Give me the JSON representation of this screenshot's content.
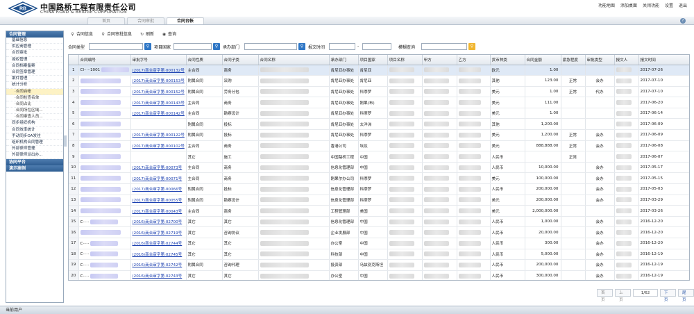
{
  "company": {
    "name_cn": "中国路桥工程有限责任公司",
    "name_en": "CHINA ROAD & BRIDGE CORPORATION",
    "logo_text": "RB"
  },
  "top_links": [
    "功能地图",
    "添加桌面",
    "关闭功能",
    "设置",
    "退出"
  ],
  "tabs": [
    "首页",
    "合同审批",
    "合同台帐"
  ],
  "sidebar": {
    "groups": [
      {
        "title": "合同管理",
        "items": [
          "基础信息",
          "供应商管理",
          "合同审批",
          "授权管理",
          "合同档案备案",
          "合同签章管理",
          "案件管理",
          "统计分析",
          "·合同台帐",
          "·合同检查名单",
          "·合同占比",
          "·合同所在区域...",
          "·合同审查人员...",
          "同步组织机构",
          "合同效率统计",
          "手动同步OA发往",
          "组织机构合同管理",
          "外部律师管理",
          "外部律师派出办..."
        ]
      },
      {
        "title": "协同平台",
        "items": []
      },
      {
        "title": "演示案例",
        "items": []
      }
    ]
  },
  "toolbar": {
    "btn1": "合同信息",
    "btn2": "合同审批信息",
    "btn3": "刷新",
    "btn4": "查询"
  },
  "filters": {
    "contract_type": "合同类型",
    "project_country": "项目国家",
    "dept": "承办部门",
    "submit_time": "报文时间",
    "dash": "-",
    "fuzzy": "模糊查询"
  },
  "table": {
    "columns": [
      "",
      "合同编号",
      "审批字号",
      "合同性质",
      "合同子类",
      "合同名称",
      "承办部门",
      "项目国家",
      "项目名称",
      "甲方",
      "乙方",
      "货币种类",
      "合同金额",
      "紧急程度",
      "审批类型",
      "报文人",
      "报文时间"
    ],
    "rows": [
      [
        "1",
        "CI·····1001",
        "(2017)商合审字第·000132号",
        "主合同",
        "商务",
        "",
        "肯尼亚办事处",
        "肯尼亚",
        "",
        "",
        "",
        "欧元",
        "1.00",
        "",
        "",
        "",
        "2017-07-26"
      ],
      [
        "2",
        "",
        "(2017)商合审字第·000153号",
        "附属合同",
        "采购",
        "",
        "肯尼亚办事处",
        "肯尼亚",
        "",
        "",
        "",
        "其他",
        "123.00",
        "正常",
        "会办",
        "",
        "2017-07-10"
      ],
      [
        "3",
        "",
        "(2017)商合审字第·000152号",
        "附属合同",
        "劳务分包",
        "",
        "肯尼亚办事处",
        "科摩罗",
        "",
        "",
        "",
        "美元",
        "1.00",
        "正常",
        "代办",
        "",
        "2017-07-10"
      ],
      [
        "4",
        "",
        "(2017)商合审字第·000143号",
        "主合同",
        "商务",
        "",
        "肯尼亚办事处",
        "刚果(布)",
        "",
        "",
        "",
        "美元",
        "111.00",
        "",
        "",
        "",
        "2017-06-20"
      ],
      [
        "5",
        "",
        "(2017)商合审字第·000142号",
        "主合同",
        "勘察设计",
        "",
        "肯尼亚办事处",
        "科摩罗",
        "",
        "",
        "",
        "美元",
        "1.00",
        "",
        "",
        "",
        "2017-06-14"
      ],
      [
        "6",
        "",
        "",
        "附属合同",
        "投标",
        "",
        "肯尼亚办事处",
        "太洋洲",
        "",
        "",
        "",
        "其他",
        "1,200.00",
        "",
        "",
        "",
        "2017-06-09"
      ],
      [
        "7",
        "",
        "(2017)商合审字第·000122号",
        "附属合同",
        "投标",
        "",
        "肯尼亚办事处",
        "科摩罗",
        "",
        "",
        "",
        "美元",
        "1,200.00",
        "正常",
        "会办",
        "",
        "2017-06-09"
      ],
      [
        "8",
        "",
        "(2017)商合审字第·000102号",
        "主合同",
        "商务",
        "",
        "香港公司",
        "埃及",
        "",
        "",
        "",
        "美元",
        "888,888.00",
        "正常",
        "会办",
        "",
        "2017-06-08"
      ],
      [
        "9",
        "",
        "",
        "其它",
        "施工",
        "",
        "中国路桥工程",
        "中国",
        "",
        "",
        "",
        "人民币",
        "",
        "正常",
        "",
        "",
        "2017-06-07"
      ],
      [
        "10",
        "",
        "(2017)商合审字第·00073号",
        "主合同",
        "商务",
        "",
        "信息化管理部",
        "中国",
        "",
        "",
        "",
        "人民币",
        "10,000.00",
        "",
        "会办",
        "",
        "2017-05-17"
      ],
      [
        "11",
        "",
        "(2017)商合审字第·00071号",
        "主合同",
        "商务",
        "",
        "刚果尔办公司",
        "科摩罗",
        "",
        "",
        "",
        "美元",
        "100,000.00",
        "",
        "会办",
        "",
        "2017-05-15"
      ],
      [
        "12",
        "",
        "(2017)商合审字第·00066号",
        "附属合同",
        "投标",
        "",
        "信息化管理部",
        "科摩罗",
        "",
        "",
        "",
        "人民币",
        "200,000.00",
        "",
        "会办",
        "",
        "2017-05-03"
      ],
      [
        "13",
        "",
        "(2017)商合审字第·00055号",
        "附属合同",
        "勘察设计",
        "",
        "信息化管理部",
        "科摩罗",
        "",
        "",
        "",
        "美元",
        "200,000.00",
        "",
        "会办",
        "",
        "2017-03-29"
      ],
      [
        "14",
        "",
        "(2017)商合审字第·00043号",
        "主合同",
        "商务",
        "",
        "工程管理部",
        "美国",
        "",
        "",
        "",
        "美元",
        "2,000,000.00",
        "",
        "",
        "",
        "2017-03-26"
      ],
      [
        "15",
        "C·····",
        "(2016)商合审字第·02700号",
        "其它",
        "其它",
        "",
        "信息化管理部",
        "中国",
        "",
        "",
        "",
        "人民币",
        "1,000.00",
        "",
        "会办",
        "",
        "2016-12-20"
      ],
      [
        "16",
        "",
        "(2016)商合审字第·02719号",
        "其它",
        "咨询协议",
        "",
        "企业发展部",
        "中国",
        "",
        "",
        "",
        "人民币",
        "20,000.00",
        "",
        "会办",
        "",
        "2016-12-20"
      ],
      [
        "17",
        "C·····",
        "(2016)商合审字第·02744号",
        "其它",
        "其它",
        "",
        "办公室",
        "中国",
        "",
        "",
        "",
        "人民币",
        "300.00",
        "",
        "会办",
        "",
        "2016-12-20"
      ],
      [
        "18",
        "C·····",
        "(2016)商合审字第·02745号",
        "其它",
        "其它",
        "",
        "科技部",
        "中国",
        "",
        "",
        "",
        "人民币",
        "5,000.00",
        "",
        "会办",
        "",
        "2016-12-19"
      ],
      [
        "19",
        "C·····",
        "(2016)商合审字第·02742号",
        "附属合同",
        "咨询代理",
        "",
        "投资部",
        "乌兹别克斯坦",
        "",
        "",
        "",
        "人民币",
        "200,000.00",
        "",
        "会办",
        "",
        "2016-12-19"
      ],
      [
        "20",
        "C·····",
        "(2016)商合审字第·02743号",
        "其它",
        "其它",
        "",
        "办公室",
        "中国",
        "",
        "",
        "",
        "人民币",
        "300,000.00",
        "",
        "会办",
        "",
        "2016-12-19"
      ]
    ]
  },
  "pager": {
    "first": "首页",
    "prev": "上页",
    "info": "1/62",
    "next": "下页",
    "last": "尾页"
  },
  "status": "当前用户"
}
